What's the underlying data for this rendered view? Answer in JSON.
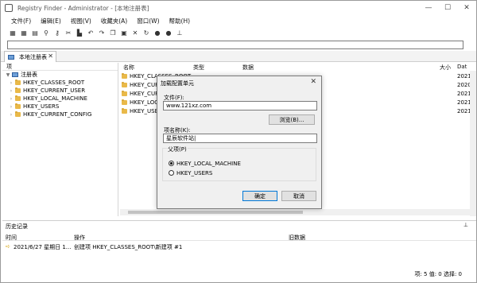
{
  "window": {
    "title": "Registry Finder - Administrator - [本地注册表]"
  },
  "menu": [
    "文件(F)",
    "编辑(E)",
    "视图(V)",
    "收藏夹(A)",
    "窗口(W)",
    "帮助(H)"
  ],
  "tab": {
    "label": "本地注册表",
    "close": "✕"
  },
  "tree": {
    "header": "项",
    "root": "注册表",
    "items": [
      "HKEY_CLASSES_ROOT",
      "HKEY_CURRENT_USER",
      "HKEY_LOCAL_MACHINE",
      "HKEY_USERS",
      "HKEY_CURRENT_CONFIG"
    ]
  },
  "list": {
    "columns": {
      "name": "名称",
      "type": "类型",
      "data": "数据",
      "size": "大小",
      "date": "Dat"
    },
    "rows": [
      {
        "name": "HKEY_CLASSES_ROOT",
        "date": "2021/"
      },
      {
        "name": "HKEY_CUR",
        "date": "2020/"
      },
      {
        "name": "HKEY_CUR",
        "date": "2021/"
      },
      {
        "name": "HKEY_LOC",
        "date": "2021/"
      },
      {
        "name": "HKEY_USE",
        "date": "2021/"
      }
    ]
  },
  "dialog": {
    "title": "加载配置单元",
    "file_label": "文件(F):",
    "file_value": "www.121xz.com",
    "browse_label": "浏览(B)...",
    "key_label": "项名称(K):",
    "key_value": "星辰软件站|",
    "parent_label": "父项(P)",
    "radio1": "HKEY_LOCAL_MACHINE",
    "radio2": "HKEY_USERS",
    "ok_label": "确定",
    "cancel_label": "取消"
  },
  "history": {
    "title": "历史记录",
    "columns": {
      "time": "时间",
      "op": "操作",
      "old": "旧数据"
    },
    "row": {
      "time": "2021/6/27 星期日 1...",
      "op": "创建项 HKEY_CLASSES_ROOT\\新建项 #1",
      "old": ""
    }
  },
  "status": {
    "text": "项: 5 值: 0 选择: 0"
  }
}
